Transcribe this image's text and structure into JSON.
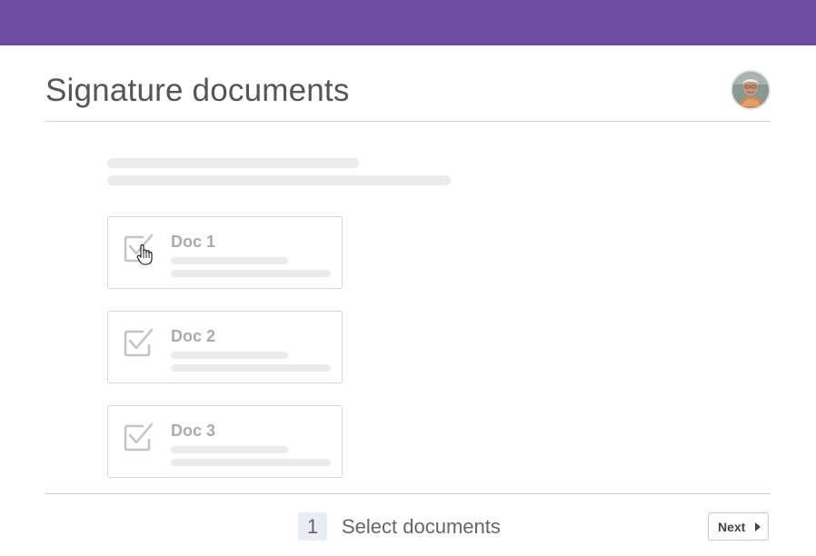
{
  "header": {
    "title": "Signature documents",
    "accent_color": "#6d4ba3"
  },
  "user": {
    "avatar_icon": "user-avatar-photo"
  },
  "documents": [
    {
      "label": "Doc 1",
      "checked": true,
      "icon": "checkbox-checked-icon"
    },
    {
      "label": "Doc 2",
      "checked": true,
      "icon": "checkbox-checked-icon"
    },
    {
      "label": "Doc 3",
      "checked": true,
      "icon": "checkbox-checked-icon"
    }
  ],
  "footer": {
    "step_number": "1",
    "step_label": "Select documents",
    "next_label": "Next",
    "next_icon": "caret-right-icon"
  },
  "pointer": {
    "icon": "hand-pointer-cursor-icon"
  }
}
